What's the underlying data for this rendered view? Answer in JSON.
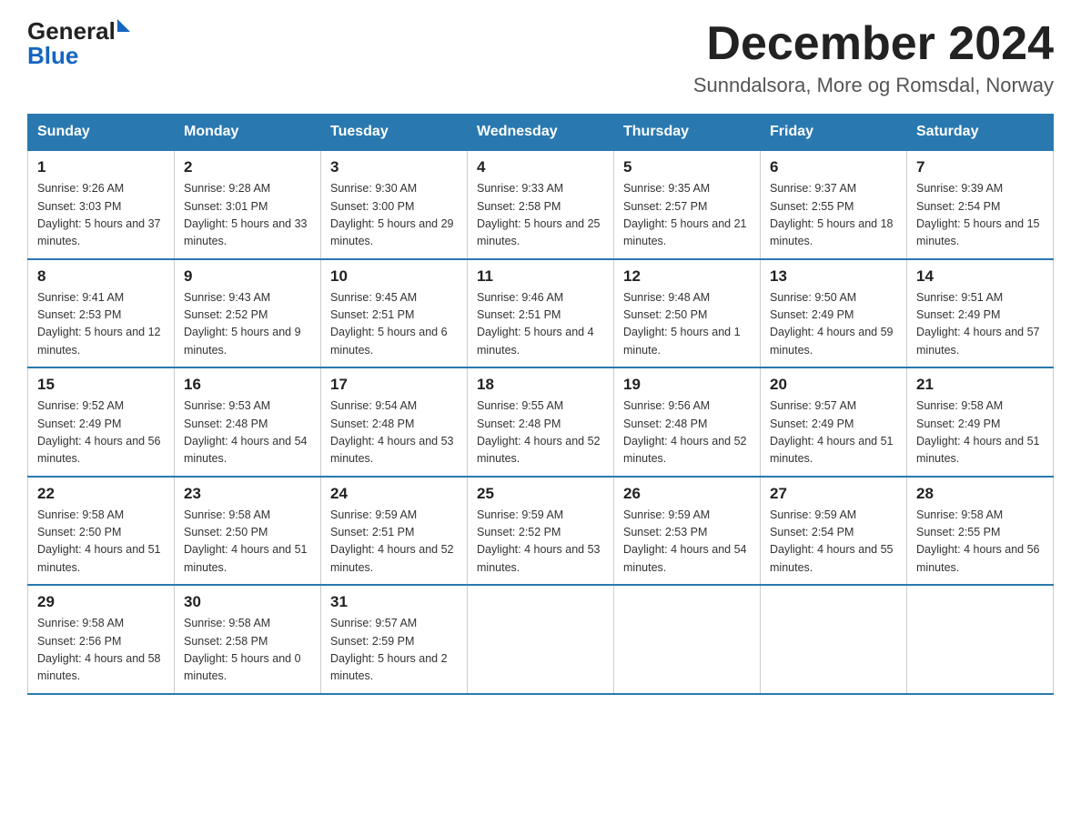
{
  "header": {
    "logo_text_general": "General",
    "logo_text_blue": "Blue",
    "month_title": "December 2024",
    "location": "Sunndalsora, More og Romsdal, Norway"
  },
  "weekdays": [
    "Sunday",
    "Monday",
    "Tuesday",
    "Wednesday",
    "Thursday",
    "Friday",
    "Saturday"
  ],
  "weeks": [
    [
      {
        "day": "1",
        "sunrise": "9:26 AM",
        "sunset": "3:03 PM",
        "daylight": "5 hours and 37 minutes."
      },
      {
        "day": "2",
        "sunrise": "9:28 AM",
        "sunset": "3:01 PM",
        "daylight": "5 hours and 33 minutes."
      },
      {
        "day": "3",
        "sunrise": "9:30 AM",
        "sunset": "3:00 PM",
        "daylight": "5 hours and 29 minutes."
      },
      {
        "day": "4",
        "sunrise": "9:33 AM",
        "sunset": "2:58 PM",
        "daylight": "5 hours and 25 minutes."
      },
      {
        "day": "5",
        "sunrise": "9:35 AM",
        "sunset": "2:57 PM",
        "daylight": "5 hours and 21 minutes."
      },
      {
        "day": "6",
        "sunrise": "9:37 AM",
        "sunset": "2:55 PM",
        "daylight": "5 hours and 18 minutes."
      },
      {
        "day": "7",
        "sunrise": "9:39 AM",
        "sunset": "2:54 PM",
        "daylight": "5 hours and 15 minutes."
      }
    ],
    [
      {
        "day": "8",
        "sunrise": "9:41 AM",
        "sunset": "2:53 PM",
        "daylight": "5 hours and 12 minutes."
      },
      {
        "day": "9",
        "sunrise": "9:43 AM",
        "sunset": "2:52 PM",
        "daylight": "5 hours and 9 minutes."
      },
      {
        "day": "10",
        "sunrise": "9:45 AM",
        "sunset": "2:51 PM",
        "daylight": "5 hours and 6 minutes."
      },
      {
        "day": "11",
        "sunrise": "9:46 AM",
        "sunset": "2:51 PM",
        "daylight": "5 hours and 4 minutes."
      },
      {
        "day": "12",
        "sunrise": "9:48 AM",
        "sunset": "2:50 PM",
        "daylight": "5 hours and 1 minute."
      },
      {
        "day": "13",
        "sunrise": "9:50 AM",
        "sunset": "2:49 PM",
        "daylight": "4 hours and 59 minutes."
      },
      {
        "day": "14",
        "sunrise": "9:51 AM",
        "sunset": "2:49 PM",
        "daylight": "4 hours and 57 minutes."
      }
    ],
    [
      {
        "day": "15",
        "sunrise": "9:52 AM",
        "sunset": "2:49 PM",
        "daylight": "4 hours and 56 minutes."
      },
      {
        "day": "16",
        "sunrise": "9:53 AM",
        "sunset": "2:48 PM",
        "daylight": "4 hours and 54 minutes."
      },
      {
        "day": "17",
        "sunrise": "9:54 AM",
        "sunset": "2:48 PM",
        "daylight": "4 hours and 53 minutes."
      },
      {
        "day": "18",
        "sunrise": "9:55 AM",
        "sunset": "2:48 PM",
        "daylight": "4 hours and 52 minutes."
      },
      {
        "day": "19",
        "sunrise": "9:56 AM",
        "sunset": "2:48 PM",
        "daylight": "4 hours and 52 minutes."
      },
      {
        "day": "20",
        "sunrise": "9:57 AM",
        "sunset": "2:49 PM",
        "daylight": "4 hours and 51 minutes."
      },
      {
        "day": "21",
        "sunrise": "9:58 AM",
        "sunset": "2:49 PM",
        "daylight": "4 hours and 51 minutes."
      }
    ],
    [
      {
        "day": "22",
        "sunrise": "9:58 AM",
        "sunset": "2:50 PM",
        "daylight": "4 hours and 51 minutes."
      },
      {
        "day": "23",
        "sunrise": "9:58 AM",
        "sunset": "2:50 PM",
        "daylight": "4 hours and 51 minutes."
      },
      {
        "day": "24",
        "sunrise": "9:59 AM",
        "sunset": "2:51 PM",
        "daylight": "4 hours and 52 minutes."
      },
      {
        "day": "25",
        "sunrise": "9:59 AM",
        "sunset": "2:52 PM",
        "daylight": "4 hours and 53 minutes."
      },
      {
        "day": "26",
        "sunrise": "9:59 AM",
        "sunset": "2:53 PM",
        "daylight": "4 hours and 54 minutes."
      },
      {
        "day": "27",
        "sunrise": "9:59 AM",
        "sunset": "2:54 PM",
        "daylight": "4 hours and 55 minutes."
      },
      {
        "day": "28",
        "sunrise": "9:58 AM",
        "sunset": "2:55 PM",
        "daylight": "4 hours and 56 minutes."
      }
    ],
    [
      {
        "day": "29",
        "sunrise": "9:58 AM",
        "sunset": "2:56 PM",
        "daylight": "4 hours and 58 minutes."
      },
      {
        "day": "30",
        "sunrise": "9:58 AM",
        "sunset": "2:58 PM",
        "daylight": "5 hours and 0 minutes."
      },
      {
        "day": "31",
        "sunrise": "9:57 AM",
        "sunset": "2:59 PM",
        "daylight": "5 hours and 2 minutes."
      },
      null,
      null,
      null,
      null
    ]
  ]
}
